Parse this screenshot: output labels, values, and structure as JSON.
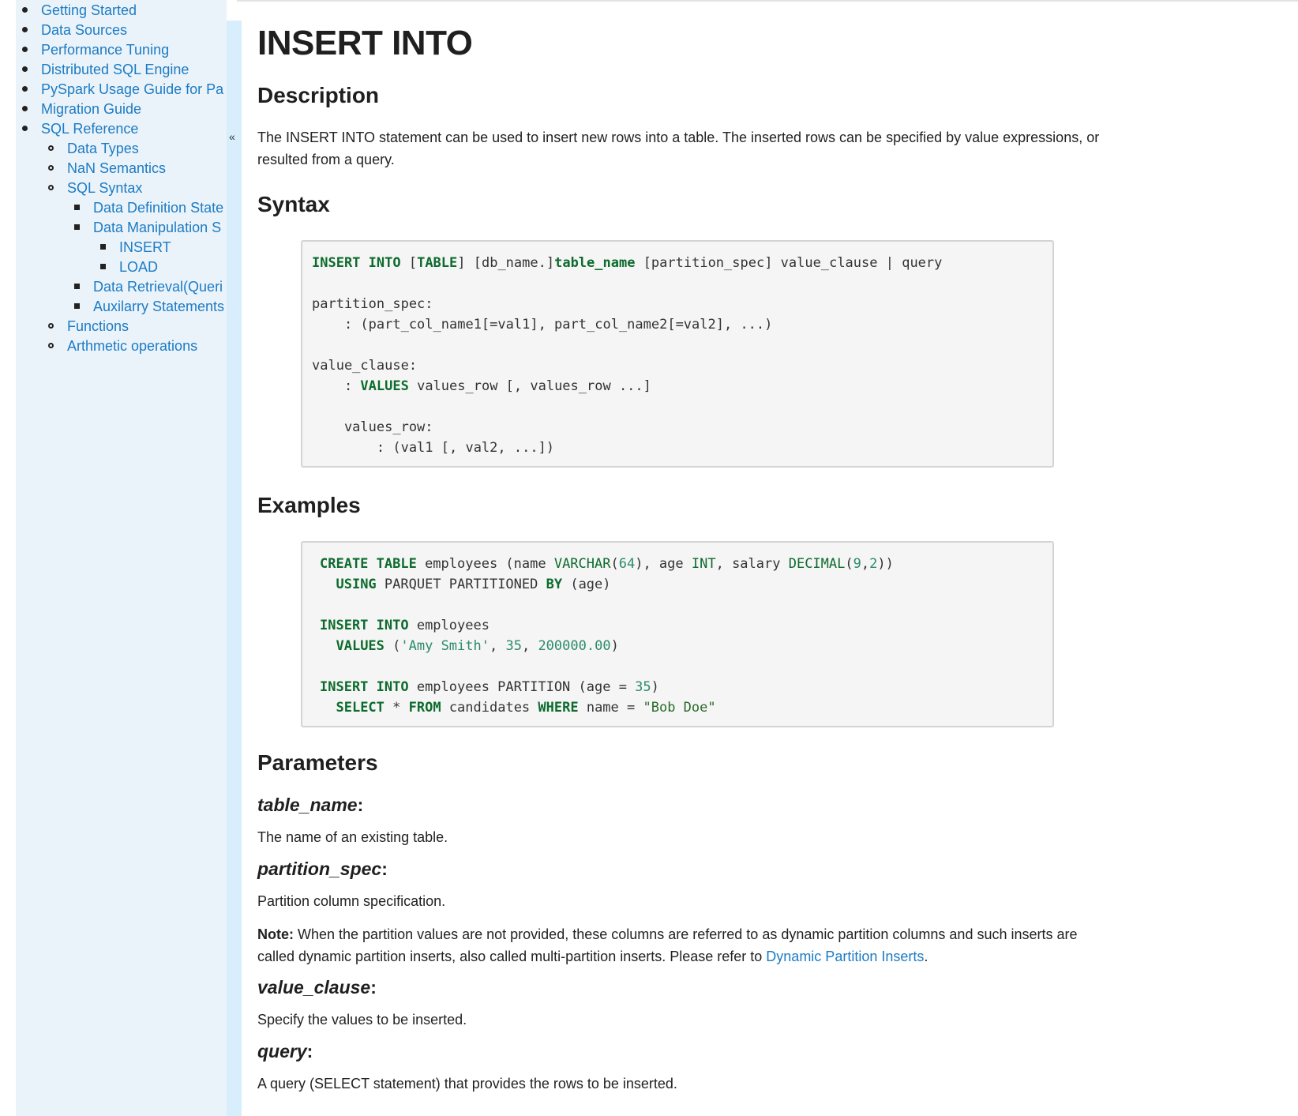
{
  "sidebar": {
    "items": [
      {
        "label": "Getting Started"
      },
      {
        "label": "Data Sources"
      },
      {
        "label": "Performance Tuning"
      },
      {
        "label": "Distributed SQL Engine"
      },
      {
        "label": "PySpark Usage Guide for Pa"
      },
      {
        "label": "Migration Guide"
      },
      {
        "label": "SQL Reference"
      },
      {
        "label": "Data Types"
      },
      {
        "label": "NaN Semantics"
      },
      {
        "label": "SQL Syntax"
      },
      {
        "label": "Data Definition State"
      },
      {
        "label": "Data Manipulation S"
      },
      {
        "label": "INSERT"
      },
      {
        "label": "LOAD"
      },
      {
        "label": "Data Retrieval(Queri"
      },
      {
        "label": "Auxilarry Statements"
      },
      {
        "label": "Functions"
      },
      {
        "label": "Arthmetic operations"
      }
    ],
    "collapse_glyph": "«"
  },
  "page": {
    "title": "INSERT INTO",
    "description_heading": "Description",
    "description_text": "The INSERT INTO statement can be used to insert new rows into a table. The inserted rows can be specified by value expressions, or resulted from a query.",
    "syntax_heading": "Syntax",
    "syntax": {
      "l1_kw1": "INSERT INTO",
      "l1_t1": " [",
      "l1_kw2": "TABLE",
      "l1_t2": "] [db_name.]",
      "l1_kw3": "table_name",
      "l1_t3": " [partition_spec] value_clause | query",
      "l2": "partition_spec:",
      "l3": "    : (part_col_name1[=val1], part_col_name2[=val2], ...)",
      "l4": "value_clause:",
      "l5_pre": "    : ",
      "l5_kw": "VALUES",
      "l5_post": " values_row [, values_row ...]",
      "l6": "    values_row:",
      "l7": "        : (val1 [, val2, ...])"
    },
    "examples_heading": "Examples",
    "example": {
      "e1_kw": "CREATE TABLE",
      "e1_a": " employees (name ",
      "e1_fn1": "VARCHAR",
      "e1_b": "(",
      "e1_n1": "64",
      "e1_c": "), age ",
      "e1_fn2": "INT",
      "e1_d": ", salary ",
      "e1_fn3": "DECIMAL",
      "e1_e": "(",
      "e1_n2": "9",
      "e1_f": ",",
      "e1_n3": "2",
      "e1_g": "))",
      "e2_pre": "  ",
      "e2_kw1": "USING",
      "e2_a": " PARQUET PARTITIONED ",
      "e2_kw2": "BY",
      "e2_b": " (age)",
      "e3_kw": "INSERT INTO",
      "e3_a": " employees",
      "e4_pre": "  ",
      "e4_kw": "VALUES",
      "e4_a": " (",
      "e4_s": "'Amy Smith'",
      "e4_b": ", ",
      "e4_n1": "35",
      "e4_c": ", ",
      "e4_n2": "200000.00",
      "e4_d": ")",
      "e5_kw": "INSERT INTO",
      "e5_a": " employees PARTITION (age = ",
      "e5_n": "35",
      "e5_b": ")",
      "e6_pre": "  ",
      "e6_kw1": "SELECT",
      "e6_a": " * ",
      "e6_kw2": "FROM",
      "e6_b": " candidates ",
      "e6_kw3": "WHERE",
      "e6_c": " name = ",
      "e6_s": "\"Bob Doe\""
    },
    "parameters_heading": "Parameters",
    "params": [
      {
        "name": "table_name",
        "desc": "The name of an existing table."
      },
      {
        "name": "partition_spec",
        "desc": "Partition column specification."
      },
      {
        "name": "value_clause",
        "desc": "Specify the values to be inserted."
      },
      {
        "name": "query",
        "desc": "A query (SELECT statement) that provides the rows to be inserted."
      }
    ],
    "colon": ":",
    "note_label": "Note:",
    "note_text": " When the partition values are not provided, these columns are referred to as dynamic partition columns and such inserts are called dynamic partition inserts, also called multi-partition inserts. Please refer to ",
    "note_link": "Dynamic Partition Inserts",
    "note_end": "."
  }
}
